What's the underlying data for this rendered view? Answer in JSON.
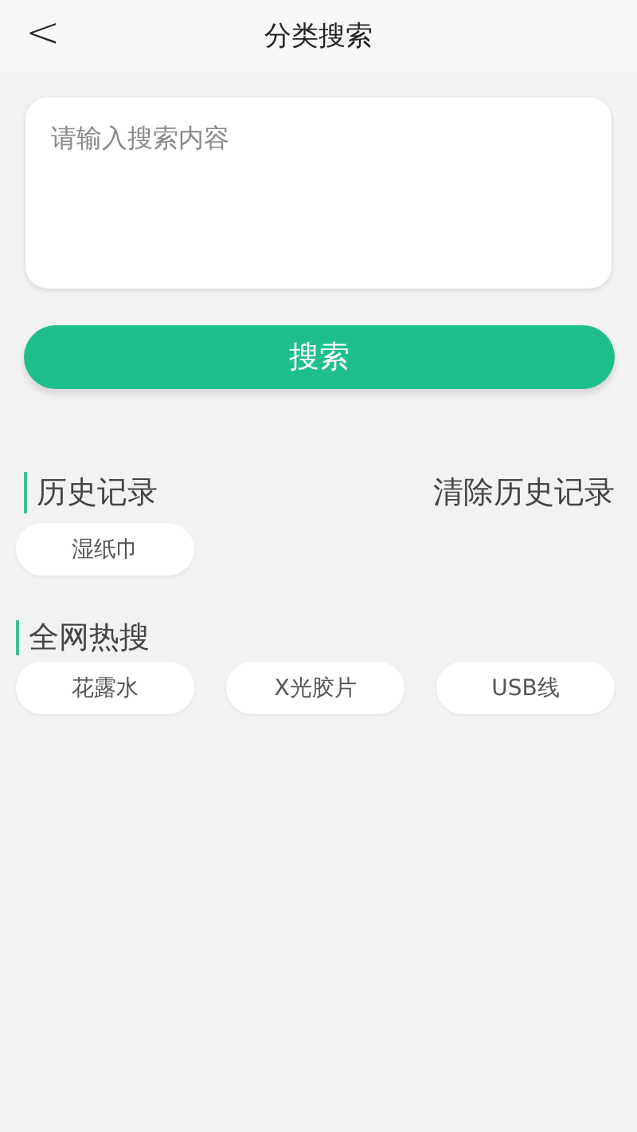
{
  "header": {
    "back": "<",
    "title": "分类搜索"
  },
  "search": {
    "placeholder": "请输入搜索内容"
  },
  "search_button": "搜索",
  "history": {
    "title": "历史记录",
    "clear": "清除历史记录",
    "items": [
      "湿纸巾"
    ]
  },
  "hot": {
    "title": "全网热搜",
    "items": [
      "花露水",
      "X光胶片",
      "USB线"
    ]
  }
}
